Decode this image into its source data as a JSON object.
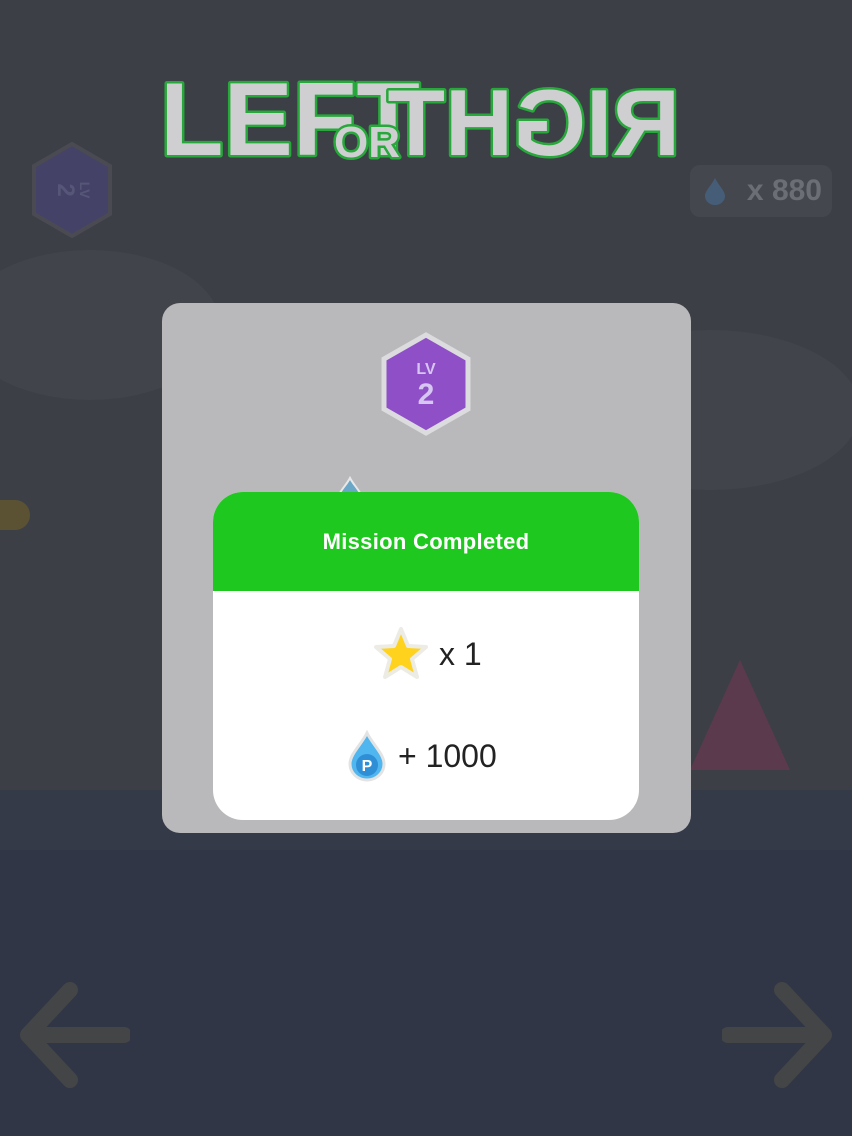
{
  "game": {
    "title_word_left": "LEFT",
    "title_word_or": "OR",
    "title_word_right": "RIGHT"
  },
  "hud": {
    "level_badge": {
      "prefix": "LV",
      "number": "2"
    },
    "points_total": "x 880"
  },
  "modal": {
    "level_badge": {
      "prefix": "LV",
      "number": "2"
    },
    "mission": {
      "title": "Mission Completed",
      "rewards": [
        {
          "icon": "star-icon",
          "text": "x 1"
        },
        {
          "icon": "point-drop-icon",
          "text": "+ 1000"
        }
      ]
    }
  },
  "colors": {
    "header_green": "#1ec81e",
    "logo_green": "#27a83a",
    "badge_purple": "#8e4fc7",
    "star_yellow": "#ffd21e",
    "drop_blue": "#4fb6ef"
  }
}
